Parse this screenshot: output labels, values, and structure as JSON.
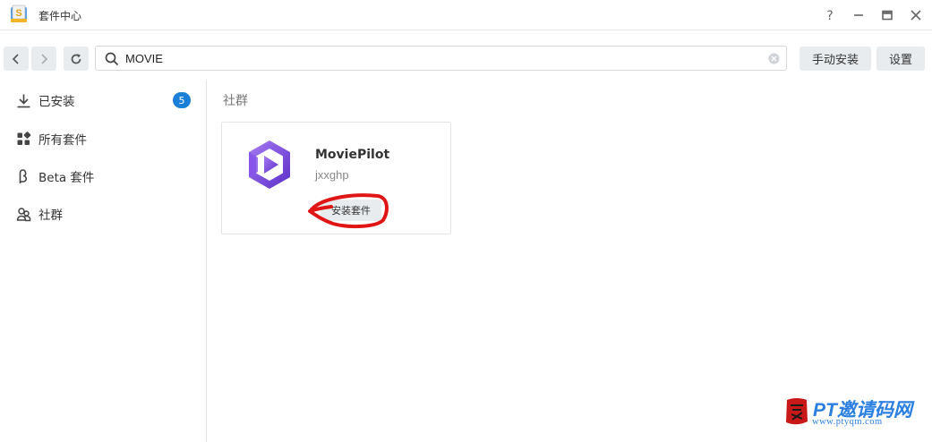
{
  "window": {
    "title": "套件中心",
    "controls": [
      "help-icon",
      "minimize-icon",
      "maximize-icon",
      "close-icon"
    ]
  },
  "toolbar": {
    "search_value": "MOVIE",
    "manual_install_label": "手动安装",
    "settings_label": "设置"
  },
  "sidebar": {
    "items": [
      {
        "label": "已安装",
        "icon": "download-icon",
        "badge": "5"
      },
      {
        "label": "所有套件",
        "icon": "grid-icon"
      },
      {
        "label": "Beta 套件",
        "icon": "beta-icon"
      },
      {
        "label": "社群",
        "icon": "community-icon"
      }
    ]
  },
  "main": {
    "section_title": "社群",
    "packages": [
      {
        "name": "MoviePilot",
        "author": "jxxghp",
        "install_label": "安装套件"
      }
    ]
  },
  "watermark": {
    "title": "PT邀请码网",
    "url": "www.ptyqm.com"
  },
  "colors": {
    "accent": "#1a7fd6",
    "annotation": "#e01515",
    "brand_purple": "#7b4fe0",
    "watermark_blue": "#2a7fe0"
  }
}
